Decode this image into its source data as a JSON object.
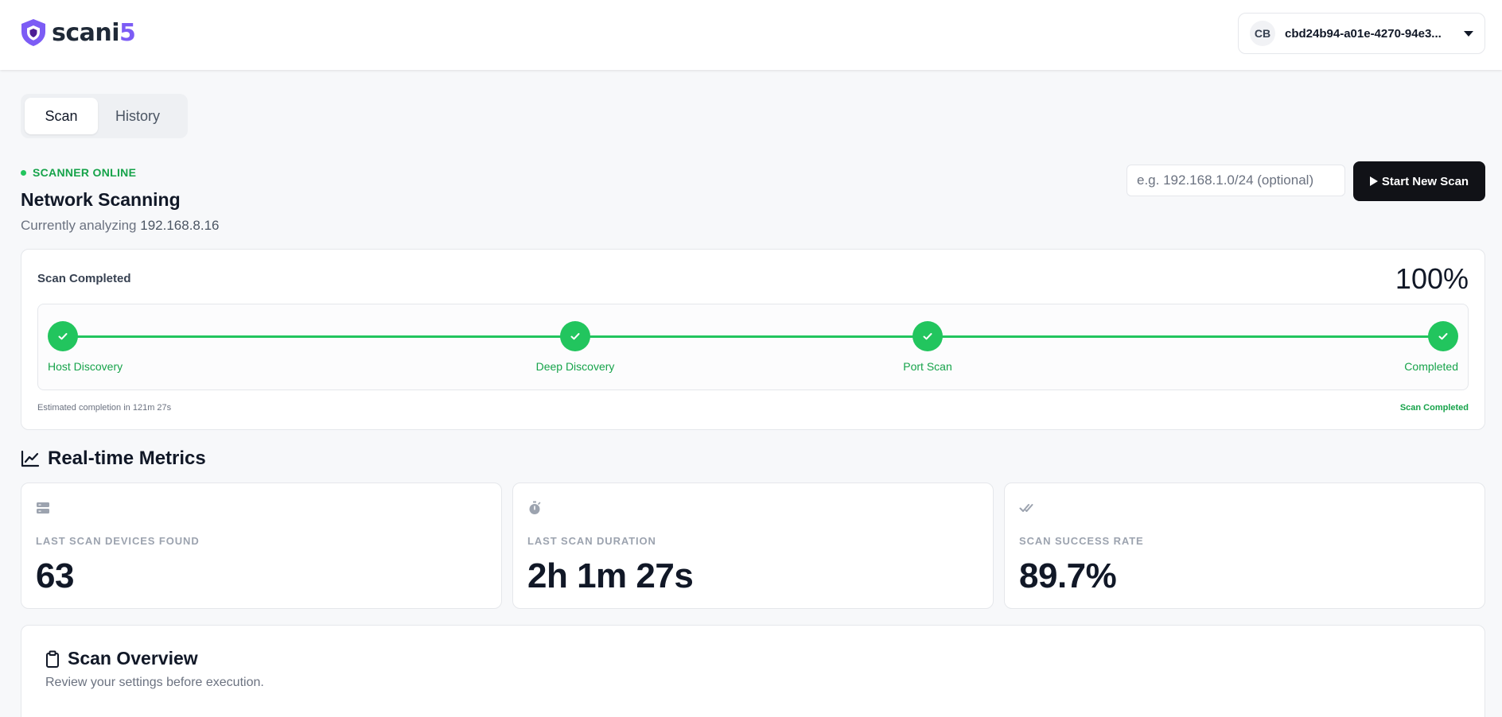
{
  "header": {
    "logo_text_main": "scani",
    "logo_text_accent": "5",
    "account_initials": "CB",
    "account_id": "cbd24b94-a01e-4270-94e3..."
  },
  "tabs": [
    {
      "label": "Scan",
      "active": true
    },
    {
      "label": "History",
      "active": false
    }
  ],
  "scanner": {
    "status": "SCANNER ONLINE",
    "title": "Network Scanning",
    "subtitle_prefix": "Currently analyzing",
    "subtitle_ip": "192.168.8.16",
    "input_placeholder": "e.g. 192.168.1.0/24 (optional)",
    "start_button": "Start New Scan"
  },
  "progress": {
    "title": "Scan Completed",
    "percent_label": "100%",
    "percent_value": 100,
    "steps": [
      {
        "label": "Host Discovery",
        "done": true
      },
      {
        "label": "Deep Discovery",
        "done": true
      },
      {
        "label": "Port Scan",
        "done": true
      },
      {
        "label": "Completed",
        "done": true
      }
    ],
    "estimate": "Estimated completion in 121m 27s",
    "status": "Scan Completed"
  },
  "metrics": {
    "heading": "Real-time Metrics",
    "cards": [
      {
        "icon": "server-icon",
        "label": "Last Scan Devices Found",
        "value": "63"
      },
      {
        "icon": "stopwatch-icon",
        "label": "Last Scan Duration",
        "value": "2h 1m 27s"
      },
      {
        "icon": "double-check-icon",
        "label": "Scan Success Rate",
        "value": "89.7%"
      }
    ]
  },
  "overview": {
    "title": "Scan Overview",
    "subtitle": "Review your settings before execution."
  },
  "colors": {
    "accent_green": "#22c55e",
    "status_green": "#16a34a",
    "brand_purple": "#7c5cf5",
    "button_dark": "#111217"
  }
}
